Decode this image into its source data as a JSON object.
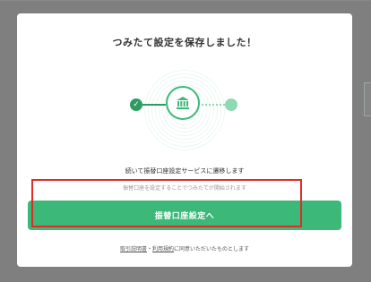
{
  "modal": {
    "title": "つみたて設定を保存しました！",
    "message": "続いて振替口座設定サービスに遷移します",
    "submessage": "振替口座を設定することでつみたてが開始されます",
    "cta_label": "振替口座設定へ",
    "terms": {
      "link1": "取引説明書",
      "separator": "・",
      "link2": "利用規約",
      "suffix": "に同意いただいたものとします"
    }
  },
  "progress": {
    "step_done_icon": "check-icon",
    "current_icon": "bank-icon"
  },
  "colors": {
    "accent": "#3cb878",
    "accent_dark": "#2e9c62",
    "accent_light": "#8fd9b1",
    "highlight": "#e02b2b"
  }
}
